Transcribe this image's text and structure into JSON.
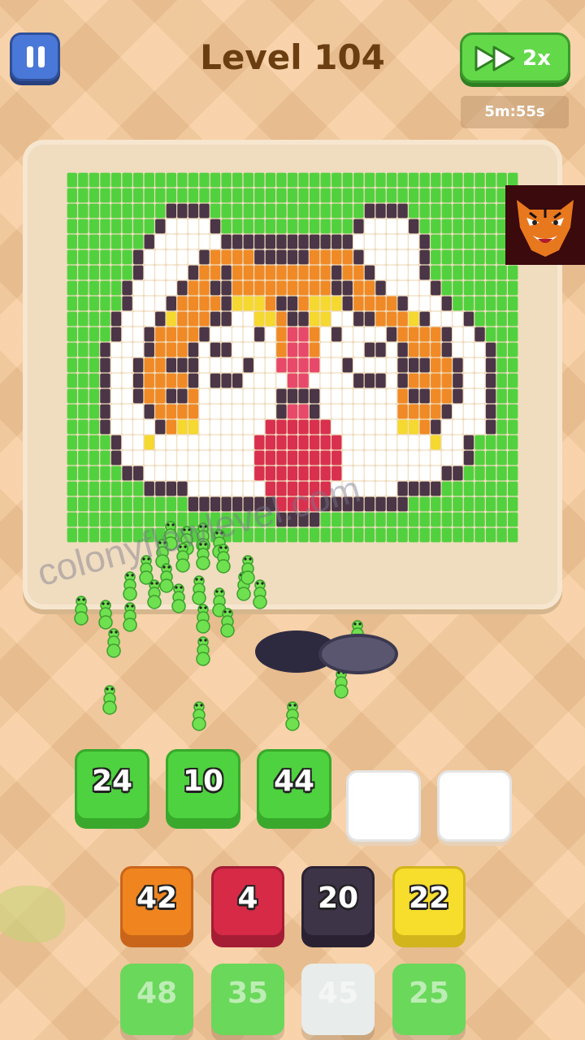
{
  "header": {
    "level_title": "Level 104",
    "speed_label": "2x",
    "timer": "5m:55s"
  },
  "board": {
    "palette": {
      "G": "#52d13f",
      "D": "#4a3646",
      "W": "#ffffff",
      "O": "#f08a26",
      "Y": "#f5d830",
      "P": "#e8496a",
      "R": "#d9304f"
    },
    "pixel_rows": [
      "GGGGGGGGGGGGGGGGGGGGGGGGGGGGGGGGGGGGGGGG",
      "GGGGGGGGGGGGGGGGGGGGGGGGGGGGGGGGGGGGGGGG",
      "GGGGGGGGGDDDDGGGGGGGGGGGGGGDDDDGGGGGGGGG",
      "GGGGGGGGDWWWWDGGGGGGGGGGGGDWWWWDGGGGGGGG",
      "GGGGGGGDWWWWWWDDDDDDDDDDDDWWWWWWDGGGGGGG",
      "GGGGGGDWWWWWDOOOODDDDDOOOODWWWWWDGGGGGG",
      "GGGGGGDWWWWDOODOOOOOOOOODOODWWWWDGGGGGG",
      "GGGGGDWWWWDOODDOOOOOOOOODDOODWWWWDGGGGG",
      "GGGGGDWWWDOOOODYYYODDOYYYDOOOODWWWDGGGGG",
      "GGGGDWWWDYOOODDWWYYODDYYWWDDOOOYDWWWDGGGG",
      "GGGGDWWDOOOODWWWWDWOPPOWDWWWWDOOOODWWDGGG",
      "GGGDWWWDOOODWDDWWWWOPPOWWWWDDWDOOODWWWDGG",
      "GGGDWWDOODDDWWWWDWWPPPPWWDWWWWDDDOODWWDGG",
      "GGGDWWDOOOODWDDDWWWWPPWWWWDDDWDOOOODWWDGG",
      "GGGDWWDOODDOWWWWWWWDDDDWWWWWWWODDOODWWDGG",
      "GGGDWWWDOOOOWWWWWWWDPPDWWWWWWWOOOODWWWDGG",
      "GGGDWWWWDOYYWWWWWWRRRRRRWWWWWWYYODWWWWDGG",
      "GGGGDWWYWWWWWWWWWRRRRRRRRWWWWWWWWYWWDGGG",
      "GGGGDWWWWWWWWWWWWRRRRRRRRWWWWWWWWWWWDGGG",
      "GGGGGDDWWWWWWWWWWRRRRRRRRWWWWWWWWWDDGGGG",
      "GGGGGGGDDDDWWWWWWWRRRRRRWWWWWWDDDDGGGGGG",
      "GGGGGGGGGGGDDDDDDDDRRRRDDDDDDDDGGGGGGGGG",
      "GGGGGGGGGGGGGGGGGGGDDDDGGGGGGGGGGGGGGGGG",
      "GGGGGGGGGGGGGGGGGGGGGGGGGGGGGGGGGGGGGGGG"
    ]
  },
  "slots": [
    {
      "value": "24",
      "color": "#4fd23f",
      "filled": true
    },
    {
      "value": "10",
      "color": "#4fd23f",
      "filled": true
    },
    {
      "value": "44",
      "color": "#4fd23f",
      "filled": true
    },
    {
      "value": "",
      "color": "#ffffff",
      "filled": false
    },
    {
      "value": "",
      "color": "#ffffff",
      "filled": false
    }
  ],
  "queue_front": [
    {
      "value": "42",
      "color": "#f0851f",
      "shade": "#c9651a"
    },
    {
      "value": "4",
      "color": "#d62a46",
      "shade": "#a51d35"
    },
    {
      "value": "20",
      "color": "#3e3448",
      "shade": "#2a2232"
    },
    {
      "value": "22",
      "color": "#f7dd2c",
      "shade": "#d2b41c"
    }
  ],
  "queue_back": [
    {
      "value": "48",
      "color": "#6ad85a"
    },
    {
      "value": "35",
      "color": "#6ad85a"
    },
    {
      "value": "45",
      "color": "#e8ecea"
    },
    {
      "value": "25",
      "color": "#6ad85a"
    }
  ],
  "watermark": "colonyflowlevel.com"
}
